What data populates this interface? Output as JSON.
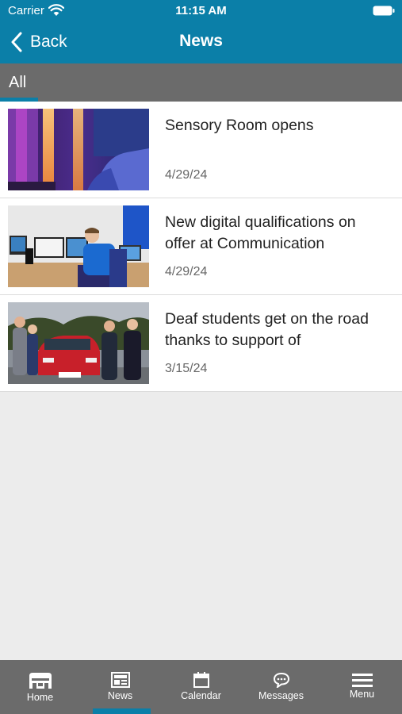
{
  "status_bar": {
    "carrier": "Carrier",
    "time": "11:15 AM",
    "icons": [
      "wifi-icon",
      "battery-icon"
    ]
  },
  "nav": {
    "back_label": "Back",
    "title": "News"
  },
  "filter": {
    "active_label": "All"
  },
  "news": [
    {
      "title": "Sensory Room opens",
      "date": "4/29/24",
      "thumbnail": "sensory-room-photo"
    },
    {
      "title": "New digital qualifications on offer at Communication",
      "date": "4/29/24",
      "thumbnail": "computer-lab-photo"
    },
    {
      "title": "Deaf students get on the road thanks to support of",
      "date": "3/15/24",
      "thumbnail": "students-red-car-photo"
    }
  ],
  "tabbar": {
    "tabs": [
      {
        "label": "Home",
        "icon": "home-icon"
      },
      {
        "label": "News",
        "icon": "news-icon"
      },
      {
        "label": "Calendar",
        "icon": "calendar-icon"
      },
      {
        "label": "Messages",
        "icon": "messages-icon"
      },
      {
        "label": "Menu",
        "icon": "menu-icon"
      }
    ],
    "active": "News"
  },
  "colors": {
    "brand": "#0b7fa8",
    "bars": "#6b6b6b",
    "background": "#ececec"
  }
}
